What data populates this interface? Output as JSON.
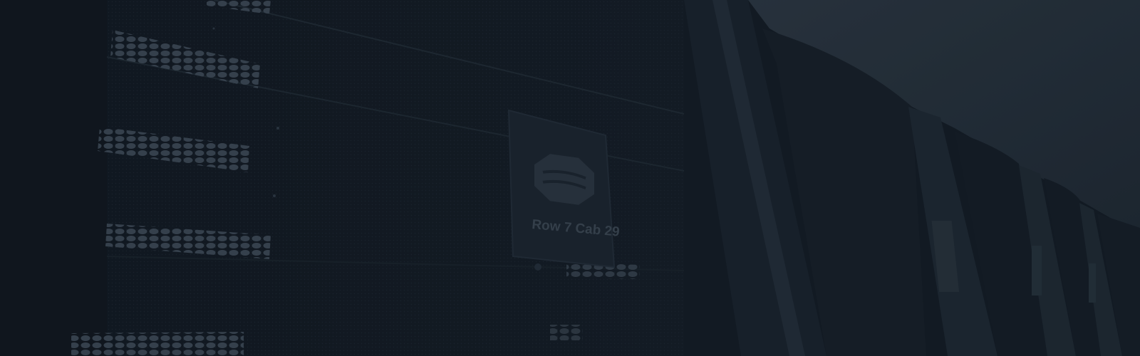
{
  "hero": {
    "cabinet_label": "Row 7 Cab 29",
    "colors": {
      "overlay": "#131b24",
      "ceiling": "#26313c",
      "rack_panel": "#161f29",
      "rack_frame": "#1c2631",
      "vent_hex": "#3b4652",
      "badge_face": "#1b242e",
      "label_text": "#3a4550"
    },
    "icons": [
      "hexagon-logo-icon"
    ]
  }
}
